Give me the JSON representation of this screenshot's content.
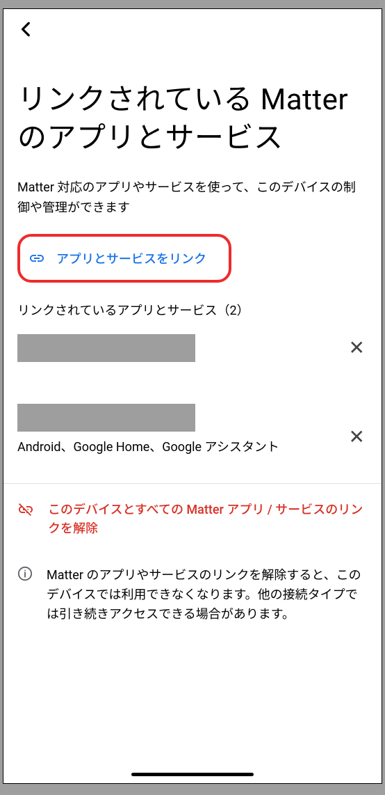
{
  "header": {
    "back": "‹"
  },
  "title": "リンクされている Matter のアプリとサービス",
  "subtitle": "Matter 対応のアプリやサービスを使って、このデバイスの制御や管理ができます",
  "linkAction": {
    "label": "アプリとサービスをリンク"
  },
  "section": {
    "heading": "リンクされているアプリとサービス（2）"
  },
  "items": [
    {
      "name": "",
      "sub": ""
    },
    {
      "name": "",
      "sub": "Android、Google Home、Google アシスタント"
    }
  ],
  "unlinkAll": "このデバイスとすべての Matter アプリ / サービスのリンクを解除",
  "infoNote": "Matter のアプリやサービスのリンクを解除すると、このデバイスでは利用できなくなります。他の接続タイプでは引き続きアクセスできる場合があります。"
}
